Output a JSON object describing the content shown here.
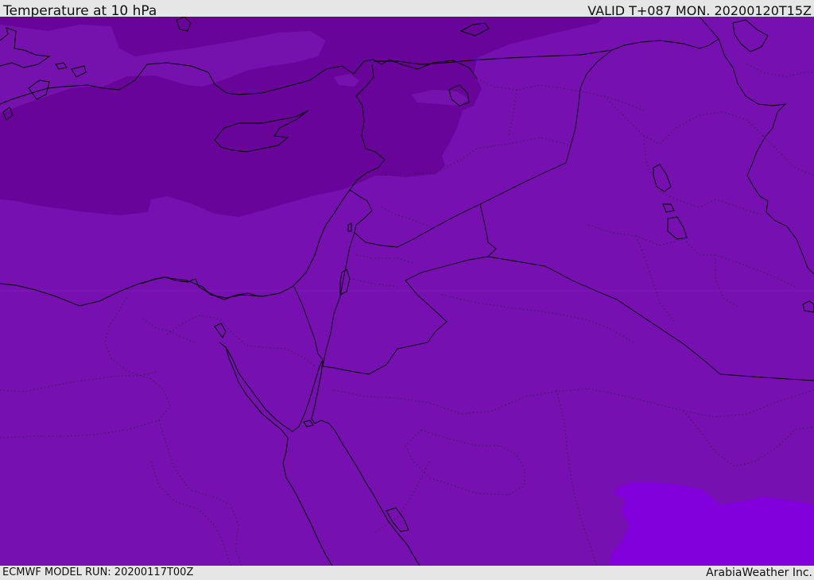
{
  "header": {
    "title": "Temperature at 10 hPa",
    "valid_time": "VALID T+087 MON. 20200120T15Z"
  },
  "footer": {
    "model_run": "ECMWF MODEL RUN: 20200117T00Z",
    "credit": "ArabiaWeather Inc."
  },
  "colors": {
    "base_field": "#7710b0",
    "cold_band": "#680499",
    "mid_band": "#7813b2",
    "warm_patch": "#8200dc",
    "bar_background": "#e6e6e6",
    "coastline": "#000000"
  },
  "map": {
    "region": "Eastern Mediterranean / Middle East",
    "layers": [
      "temperature-field",
      "coastlines",
      "country-borders",
      "province-borders"
    ]
  }
}
